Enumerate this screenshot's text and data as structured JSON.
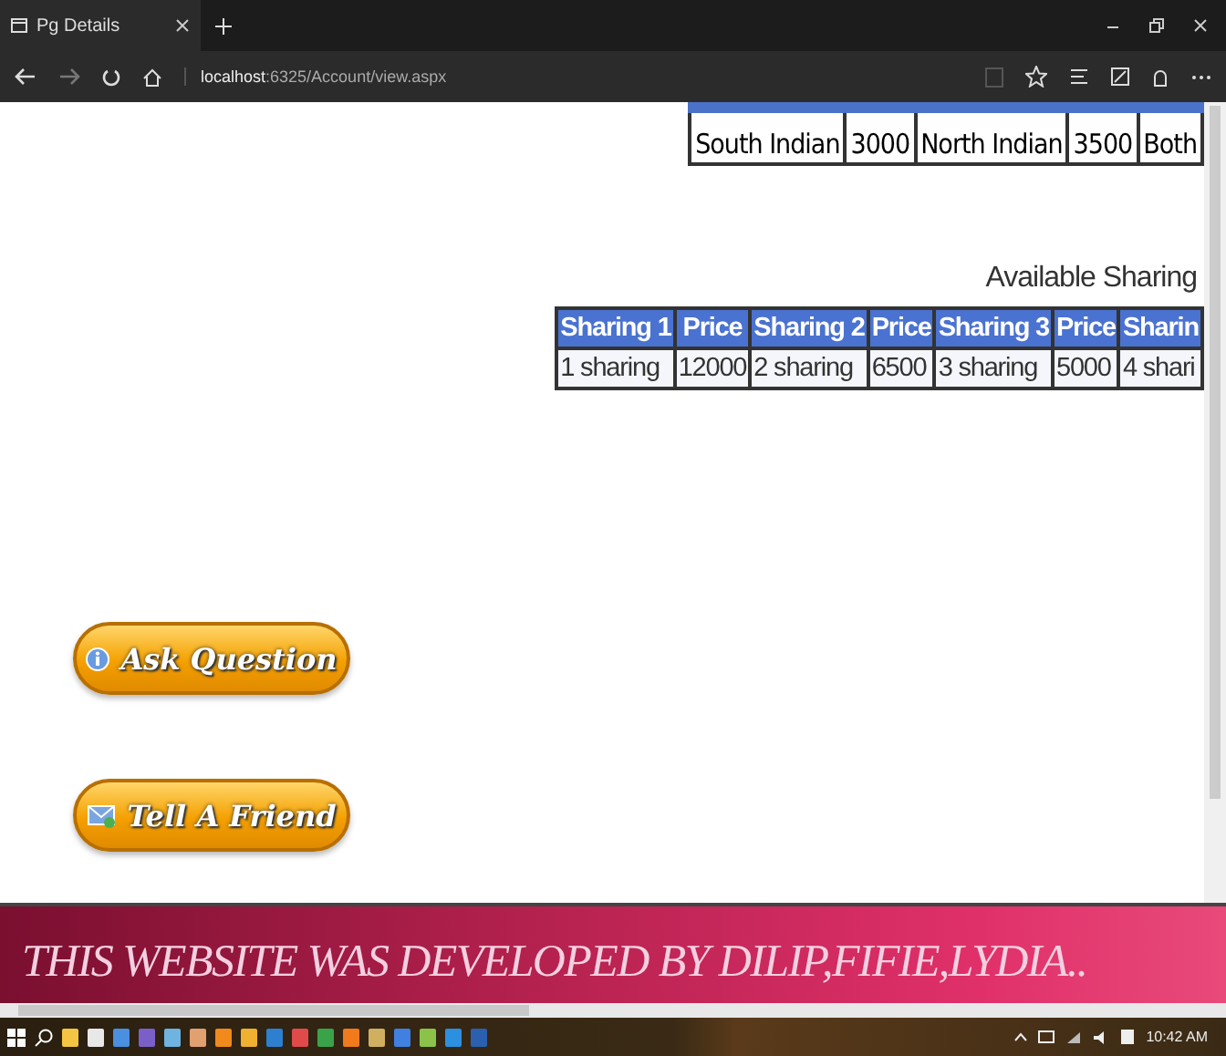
{
  "window": {
    "tab_title": "Pg Details",
    "url_host": "localhost",
    "url_path": ":6325/Account/view.aspx"
  },
  "food_table": {
    "rows": [
      [
        "South Indian",
        "3000",
        "North Indian",
        "3500",
        "Both"
      ]
    ]
  },
  "sharing_section": {
    "heading": "Available Sharing",
    "columns": [
      "Sharing 1",
      "Price",
      "Sharing 2",
      "Price",
      "Sharing 3",
      "Price",
      "Sharin"
    ],
    "rows": [
      [
        "1 sharing",
        "12000",
        "2 sharing",
        "6500",
        "3 sharing",
        "5000",
        "4 shari"
      ]
    ]
  },
  "buttons": [
    {
      "label": "Ask Question",
      "kind": "question"
    },
    {
      "label": "Tell A Friend",
      "kind": "mail"
    }
  ],
  "footer": {
    "text": "THIS WEBSITE WAS DEVELOPED BY DILIP,FIFIE,LYDIA.."
  },
  "taskbar": {
    "clock": "10:42 AM"
  }
}
